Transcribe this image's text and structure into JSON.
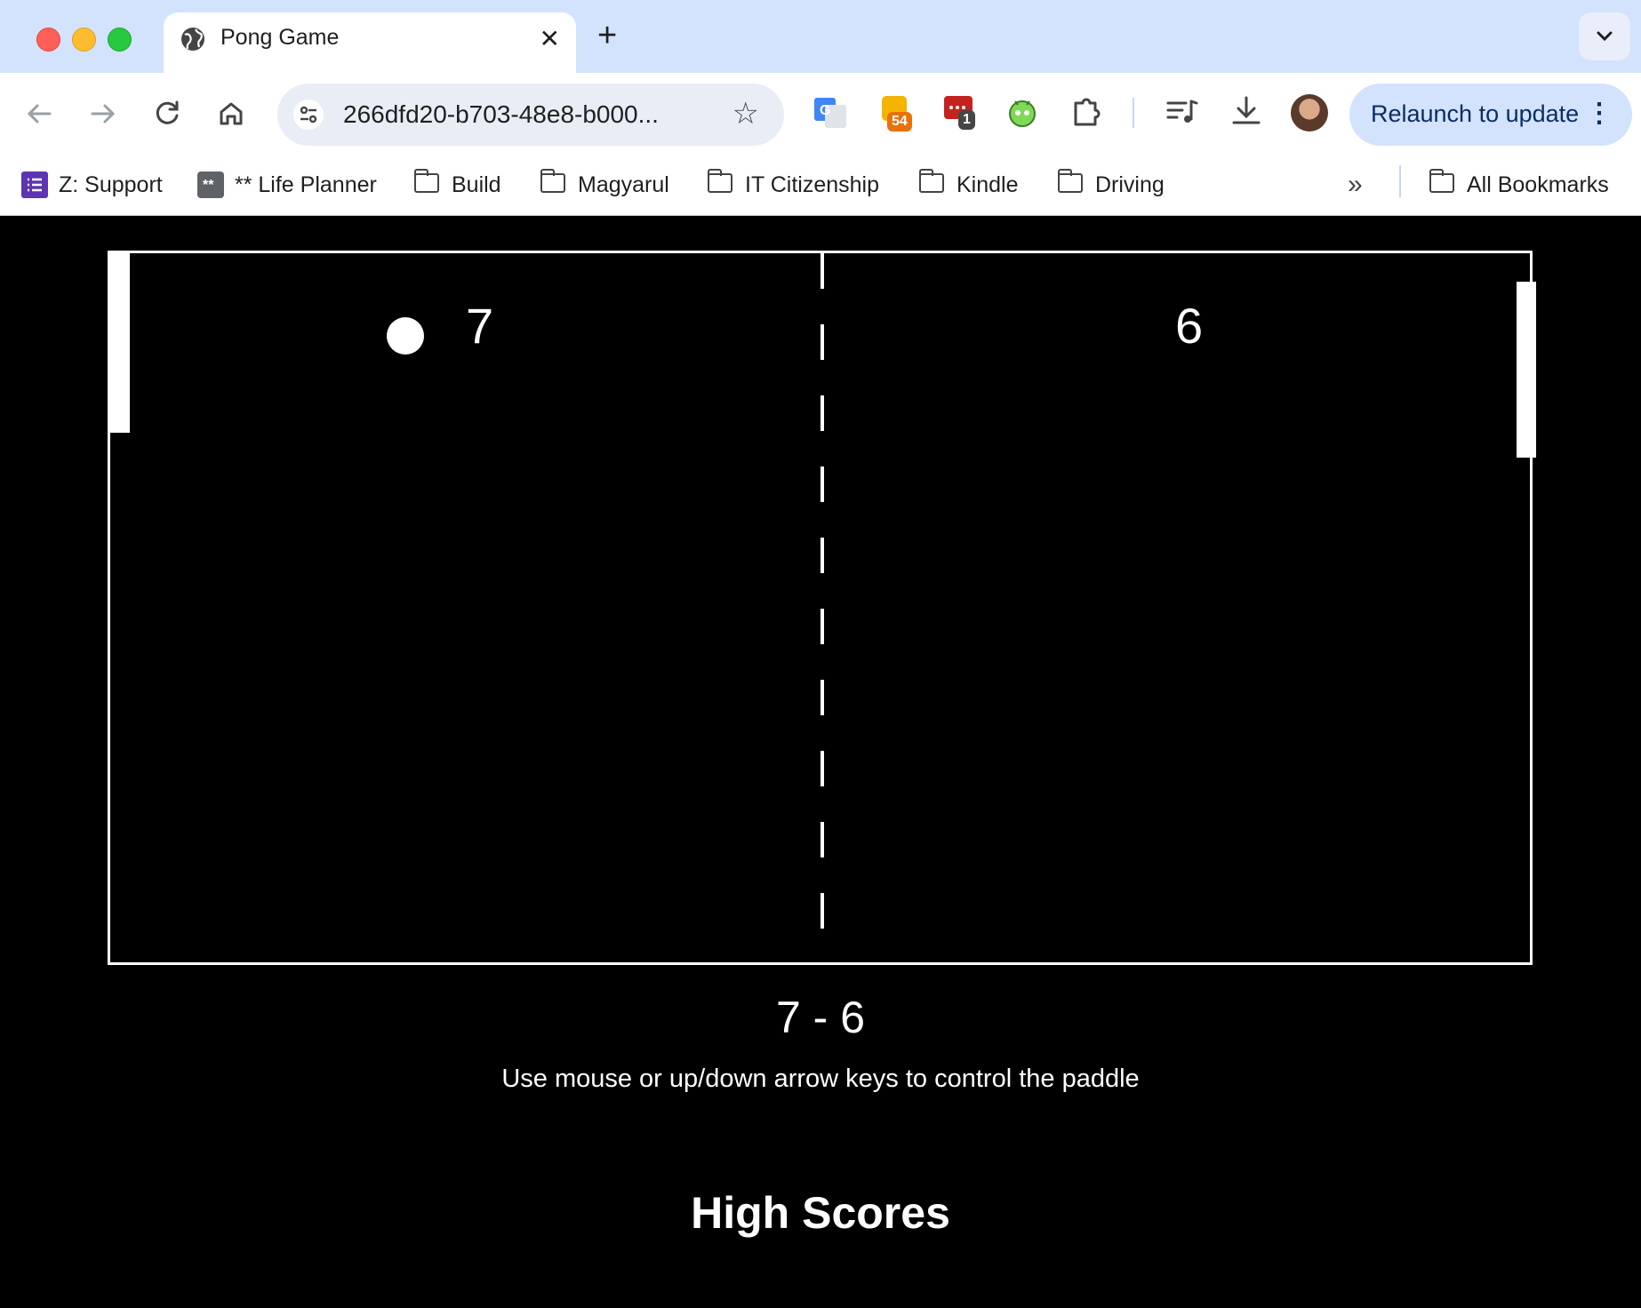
{
  "browser": {
    "tab": {
      "title": "Pong Game"
    },
    "new_tab_label": "+",
    "address": {
      "url": "266dfd20-b703-48e8-b000..."
    },
    "extensions": [
      {
        "name": "google-translate-icon"
      },
      {
        "name": "rss-extension-icon",
        "badge": "54",
        "badge_color": "#e8710a"
      },
      {
        "name": "chat-extension-icon",
        "badge": "1",
        "badge_color": "#444746"
      },
      {
        "name": "android-robot-icon"
      },
      {
        "name": "puzzle-icon"
      }
    ],
    "relaunch": {
      "label": "Relaunch to update"
    },
    "bookmarks": [
      {
        "label": "Z: Support",
        "icon": "list-icon"
      },
      {
        "label": "** Life Planner",
        "icon": "asterisk-square-icon"
      },
      {
        "label": "Build",
        "icon": "folder-icon"
      },
      {
        "label": "Magyarul",
        "icon": "folder-icon"
      },
      {
        "label": "IT Citizenship",
        "icon": "folder-icon"
      },
      {
        "label": "Kindle",
        "icon": "folder-icon"
      },
      {
        "label": "Driving",
        "icon": "folder-icon"
      }
    ],
    "bookmarks_overflow": "»",
    "all_bookmarks_label": "All Bookmarks"
  },
  "game": {
    "left_score": "7",
    "right_score": "6",
    "scoreline": "7 - 6",
    "instructions": "Use mouse or up/down arrow keys to control the paddle",
    "high_scores_title": "High Scores"
  }
}
